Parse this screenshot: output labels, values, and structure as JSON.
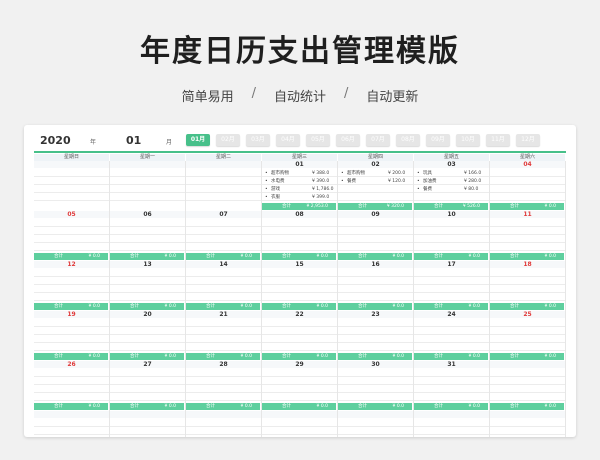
{
  "header": {
    "title": "年度日历支出管理模版",
    "tags": [
      "简单易用",
      "自动统计",
      "自动更新"
    ],
    "sep": "/"
  },
  "topbar": {
    "year": "2020",
    "year_unit": "年",
    "month": "01",
    "month_unit": "月"
  },
  "months": [
    "01月",
    "02月",
    "03月",
    "04月",
    "05月",
    "06月",
    "07月",
    "08月",
    "09月",
    "10月",
    "11月",
    "12月"
  ],
  "weekdays": [
    "星期日",
    "星期一",
    "星期二",
    "星期三",
    "星期四",
    "星期五",
    "星期六"
  ],
  "total_label": "合计",
  "weeks": [
    [
      {
        "day": "",
        "red": false,
        "total": "",
        "entries": []
      },
      {
        "day": "",
        "red": false,
        "total": "",
        "entries": []
      },
      {
        "day": "",
        "red": false,
        "total": "",
        "entries": []
      },
      {
        "day": "01",
        "red": false,
        "total": "¥ 2,953.0",
        "entries": [
          {
            "n": "超市购物",
            "a": "¥ 388.0"
          },
          {
            "n": "水电费",
            "a": "¥ 390.0"
          },
          {
            "n": "游戏",
            "a": "¥ 1,786.0"
          },
          {
            "n": "衣服",
            "a": "¥ 399.0"
          }
        ]
      },
      {
        "day": "02",
        "red": false,
        "total": "¥ 320.0",
        "entries": [
          {
            "n": "超市购物",
            "a": "¥ 200.0"
          },
          {
            "n": "餐费",
            "a": "¥ 120.0"
          }
        ]
      },
      {
        "day": "03",
        "red": false,
        "total": "¥ 526.0",
        "entries": [
          {
            "n": "玩具",
            "a": "¥ 166.0"
          },
          {
            "n": "加油费",
            "a": "¥ 280.0"
          },
          {
            "n": "餐费",
            "a": "¥ 80.0"
          }
        ]
      },
      {
        "day": "04",
        "red": true,
        "total": "¥ 0.0",
        "entries": []
      }
    ],
    [
      {
        "day": "05",
        "red": true,
        "total": "¥ 0.0",
        "entries": []
      },
      {
        "day": "06",
        "red": false,
        "total": "¥ 0.0",
        "entries": []
      },
      {
        "day": "07",
        "red": false,
        "total": "¥ 0.0",
        "entries": []
      },
      {
        "day": "08",
        "red": false,
        "total": "¥ 0.0",
        "entries": []
      },
      {
        "day": "09",
        "red": false,
        "total": "¥ 0.0",
        "entries": []
      },
      {
        "day": "10",
        "red": false,
        "total": "¥ 0.0",
        "entries": []
      },
      {
        "day": "11",
        "red": true,
        "total": "¥ 0.0",
        "entries": []
      }
    ],
    [
      {
        "day": "12",
        "red": true,
        "total": "¥ 0.0",
        "entries": []
      },
      {
        "day": "13",
        "red": false,
        "total": "¥ 0.0",
        "entries": []
      },
      {
        "day": "14",
        "red": false,
        "total": "¥ 0.0",
        "entries": []
      },
      {
        "day": "15",
        "red": false,
        "total": "¥ 0.0",
        "entries": []
      },
      {
        "day": "16",
        "red": false,
        "total": "¥ 0.0",
        "entries": []
      },
      {
        "day": "17",
        "red": false,
        "total": "¥ 0.0",
        "entries": []
      },
      {
        "day": "18",
        "red": true,
        "total": "¥ 0.0",
        "entries": []
      }
    ],
    [
      {
        "day": "19",
        "red": true,
        "total": "¥ 0.0",
        "entries": []
      },
      {
        "day": "20",
        "red": false,
        "total": "¥ 0.0",
        "entries": []
      },
      {
        "day": "21",
        "red": false,
        "total": "¥ 0.0",
        "entries": []
      },
      {
        "day": "22",
        "red": false,
        "total": "¥ 0.0",
        "entries": []
      },
      {
        "day": "23",
        "red": false,
        "total": "¥ 0.0",
        "entries": []
      },
      {
        "day": "24",
        "red": false,
        "total": "¥ 0.0",
        "entries": []
      },
      {
        "day": "25",
        "red": true,
        "total": "¥ 0.0",
        "entries": []
      }
    ],
    [
      {
        "day": "26",
        "red": true,
        "total": "¥ 0.0",
        "entries": []
      },
      {
        "day": "27",
        "red": false,
        "total": "¥ 0.0",
        "entries": []
      },
      {
        "day": "28",
        "red": false,
        "total": "¥ 0.0",
        "entries": []
      },
      {
        "day": "29",
        "red": false,
        "total": "¥ 0.0",
        "entries": []
      },
      {
        "day": "30",
        "red": false,
        "total": "¥ 0.0",
        "entries": []
      },
      {
        "day": "31",
        "red": false,
        "total": "¥ 0.0",
        "entries": []
      },
      {
        "day": "",
        "red": false,
        "total": "¥ 0.0",
        "entries": []
      }
    ],
    [
      {
        "day": "",
        "red": false,
        "total": "¥ 0.0",
        "entries": []
      },
      {
        "day": "",
        "red": false,
        "total": "¥ 0.0",
        "entries": []
      },
      {
        "day": "",
        "red": false,
        "total": "¥ 0.0",
        "entries": []
      },
      {
        "day": "",
        "red": false,
        "total": "¥ 0.0",
        "entries": []
      },
      {
        "day": "",
        "red": false,
        "total": "¥ 0.0",
        "entries": []
      },
      {
        "day": "",
        "red": false,
        "total": "¥ 0.0",
        "entries": []
      },
      {
        "day": "",
        "red": false,
        "total": "¥ 0.0",
        "entries": []
      }
    ]
  ]
}
